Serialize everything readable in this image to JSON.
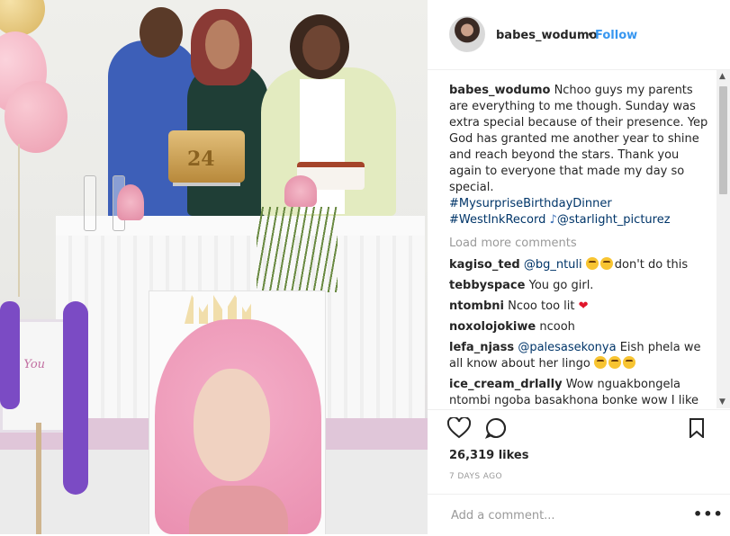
{
  "post": {
    "username": "babes_wodumo",
    "separator": "•",
    "follow_label": "Follow",
    "caption_text": "Nchoo guys my parents are everything to me though. Sunday was extra special because of their presence. Yep God has granted me another year to shine and reach beyond the stars. Thank you again to everyone that made my day so special.",
    "hashtag_1": "#MysurpriseBirthdayDinner",
    "hashtag_2": "#WestInkRecord",
    "mention": "@starlight_picturez",
    "load_more_label": "Load more comments"
  },
  "comments": [
    {
      "user": "kagiso_ted",
      "mention": "@bg_ntuli",
      "text": "don't do this"
    },
    {
      "user": "tebbyspace",
      "text": "You go girl."
    },
    {
      "user": "ntombni",
      "text": "Ncoo too lit"
    },
    {
      "user": "noxolojokiwe",
      "text": "ncooh"
    },
    {
      "user": "lefa_njass",
      "mention": "@palesasekonya",
      "text": "Eish phela we all know about her lingo"
    },
    {
      "user": "ice_cream_drlally",
      "text": "Wow nguakbongela ntombi ngoba basakhona bonke wow I like that"
    }
  ],
  "stats": {
    "likes": "26,319 likes",
    "time": "7 DAYS AGO"
  },
  "add_comment": {
    "placeholder": "Add a comment...",
    "more_label": "•••"
  },
  "photo": {
    "cake_number": "24",
    "sign_text": "nk You"
  },
  "icons": [
    "heart-icon",
    "comment-icon",
    "bookmark-icon",
    "more-options-icon",
    "scroll-up-icon",
    "scroll-down-icon"
  ],
  "colors": {
    "accent": "#3897f0",
    "hashtag": "#003569",
    "muted": "#999999",
    "text": "#262626"
  }
}
